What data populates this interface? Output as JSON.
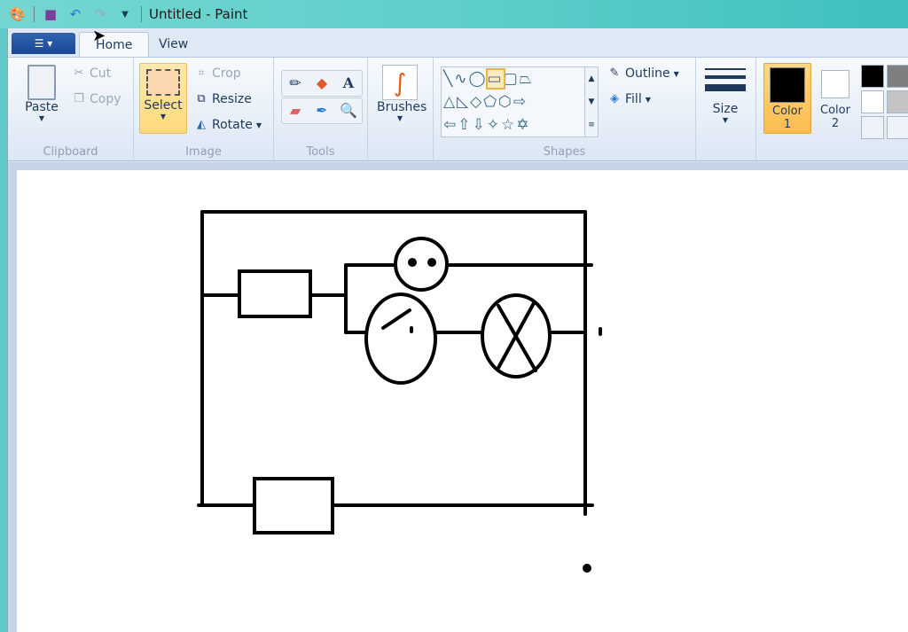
{
  "title": "Untitled - Paint",
  "quick_access": [
    {
      "icon": "paint-app-icon"
    },
    {
      "icon": "save-icon"
    },
    {
      "icon": "undo-icon"
    },
    {
      "icon": "redo-icon"
    },
    {
      "icon": "customize-dropdown-icon"
    }
  ],
  "tabs": [
    {
      "label": "Home",
      "active": true
    },
    {
      "label": "View",
      "active": false
    }
  ],
  "clipboard": {
    "label": "Clipboard",
    "paste": "Paste",
    "cut": "Cut",
    "copy": "Copy"
  },
  "image": {
    "label": "Image",
    "select": "Select",
    "crop": "Crop",
    "resize": "Resize",
    "rotate": "Rotate"
  },
  "tools": {
    "label": "Tools",
    "items": [
      "pencil",
      "fill",
      "text",
      "eraser",
      "color-picker",
      "magnifier"
    ]
  },
  "brushes": {
    "label": "Brushes"
  },
  "shapes": {
    "label": "Shapes",
    "outline": "Outline",
    "fill": "Fill",
    "selected": "rectangle"
  },
  "size": {
    "label": "Size"
  },
  "colors": {
    "color1_label": "Color",
    "color1_num": "1",
    "color2_label": "Color",
    "color2_num": "2",
    "color1": "#000000",
    "color2": "#ffffff",
    "palette": [
      "#000000",
      "#7f7f7f",
      "#ffffff",
      "#c3c3c3"
    ]
  }
}
